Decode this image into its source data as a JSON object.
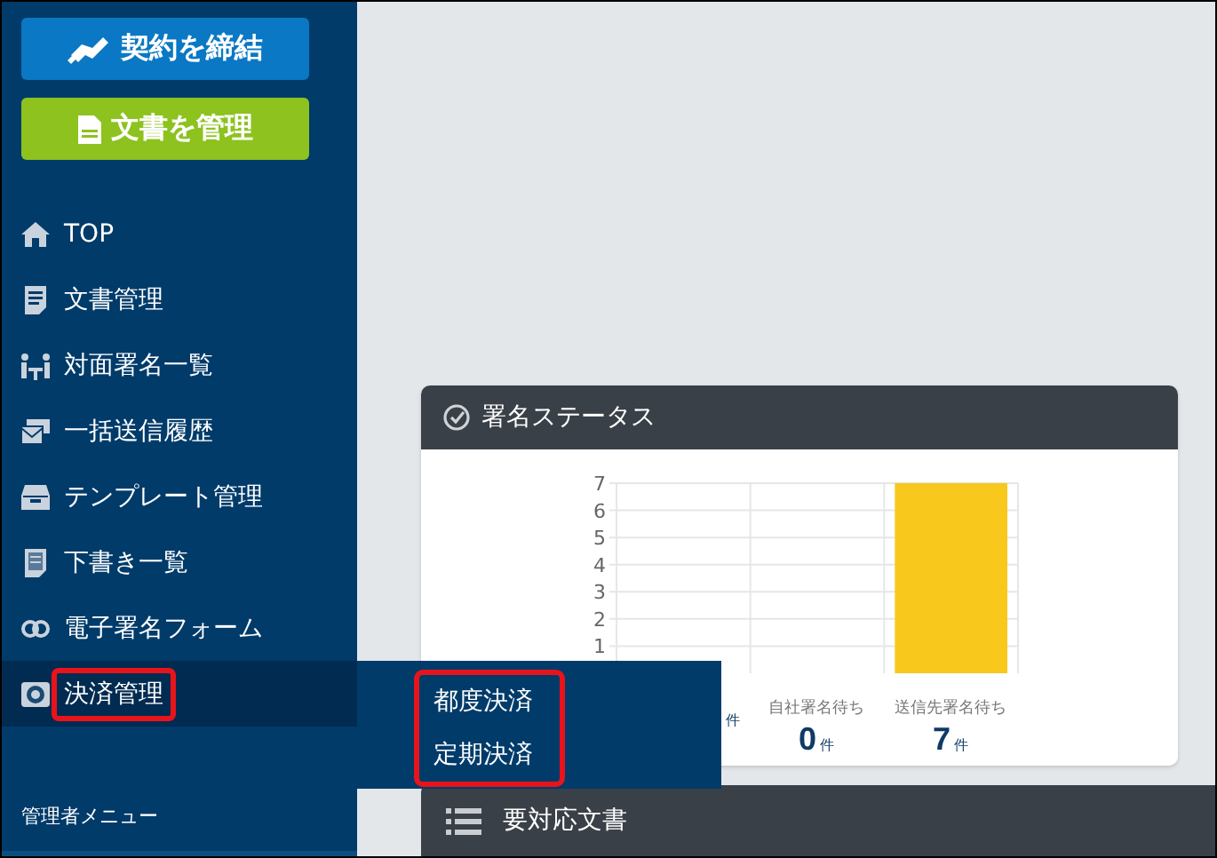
{
  "sidebar": {
    "buttons": [
      {
        "label": "契約を締結",
        "kind": "contract"
      },
      {
        "label": "文書を管理",
        "kind": "document"
      }
    ],
    "items": [
      {
        "label": "TOP",
        "kind": "home",
        "selected": false,
        "highlighted": false
      },
      {
        "label": "文書管理",
        "kind": "document",
        "selected": false,
        "highlighted": false
      },
      {
        "label": "対面署名一覧",
        "kind": "meeting",
        "selected": false,
        "highlighted": false
      },
      {
        "label": "一括送信履歴",
        "kind": "bulk",
        "selected": false,
        "highlighted": false
      },
      {
        "label": "テンプレート管理",
        "kind": "template",
        "selected": false,
        "highlighted": false
      },
      {
        "label": "下書き一覧",
        "kind": "draft",
        "selected": false,
        "highlighted": false
      },
      {
        "label": "電子署名フォーム",
        "kind": "link",
        "selected": false,
        "highlighted": false
      },
      {
        "label": "決済管理",
        "kind": "payment",
        "selected": true,
        "highlighted": true
      }
    ],
    "section_label": "管理者メニュー"
  },
  "submenu": {
    "highlighted": true,
    "items": [
      {
        "label": "都度決済"
      },
      {
        "label": "定期決済"
      }
    ]
  },
  "status_card": {
    "title": "署名ステータス",
    "chart_data": {
      "type": "bar",
      "values": [
        0,
        0,
        7
      ],
      "ylim": [
        0,
        7
      ],
      "grid": true,
      "yticks": [
        1,
        2,
        3,
        4,
        5,
        6,
        7
      ]
    },
    "stats": [
      {
        "unit": "件"
      },
      {
        "label": "自社署名待ち",
        "count": "0",
        "unit": "件"
      },
      {
        "label": "送信先署名待ち",
        "count": "7",
        "unit": "件"
      }
    ]
  },
  "todo_card": {
    "title": "要対応文書"
  }
}
